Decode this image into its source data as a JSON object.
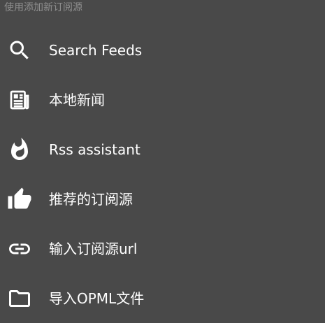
{
  "header": {
    "hint": "使用添加新订阅源"
  },
  "menu": {
    "items": [
      {
        "icon": "search-icon",
        "label": "Search Feeds"
      },
      {
        "icon": "newspaper-icon",
        "label": "本地新闻"
      },
      {
        "icon": "flame-icon",
        "label": "Rss assistant"
      },
      {
        "icon": "thumb-up-icon",
        "label": "推荐的订阅源"
      },
      {
        "icon": "link-icon",
        "label": "输入订阅源url"
      },
      {
        "icon": "folder-icon",
        "label": "导入OPML文件"
      }
    ]
  },
  "colors": {
    "background": "#494949",
    "text": "#ffffff",
    "hint_text": "#8f8f8f"
  }
}
